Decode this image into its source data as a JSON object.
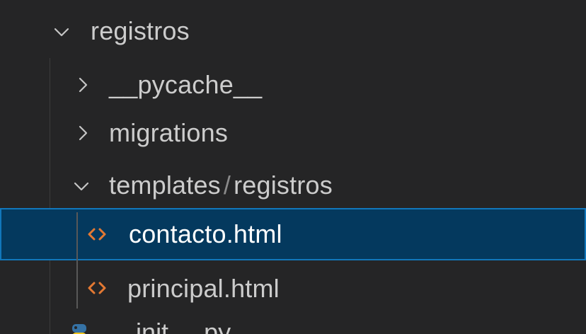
{
  "tree": {
    "items": [
      {
        "label": "registros",
        "type": "folder",
        "state": "expanded"
      },
      {
        "label": "__pycache__",
        "type": "folder",
        "state": "collapsed"
      },
      {
        "label": "migrations",
        "type": "folder",
        "state": "collapsed"
      },
      {
        "label_part1": "templates",
        "separator": "/",
        "label_part2": "registros",
        "type": "folder",
        "state": "expanded"
      },
      {
        "label": "contacto.html",
        "type": "file",
        "icon": "html-icon",
        "selected": true
      },
      {
        "label": "principal.html",
        "type": "file",
        "icon": "html-icon",
        "selected": false
      },
      {
        "label": "__init__.py",
        "type": "file",
        "icon": "python-icon",
        "selected": false
      }
    ]
  },
  "colors": {
    "background": "#252526",
    "selection": "#04395e",
    "selection_border": "#1177bb",
    "text": "#cccccc",
    "html_icon": "#e37933",
    "python_icon": "#3572a5"
  }
}
